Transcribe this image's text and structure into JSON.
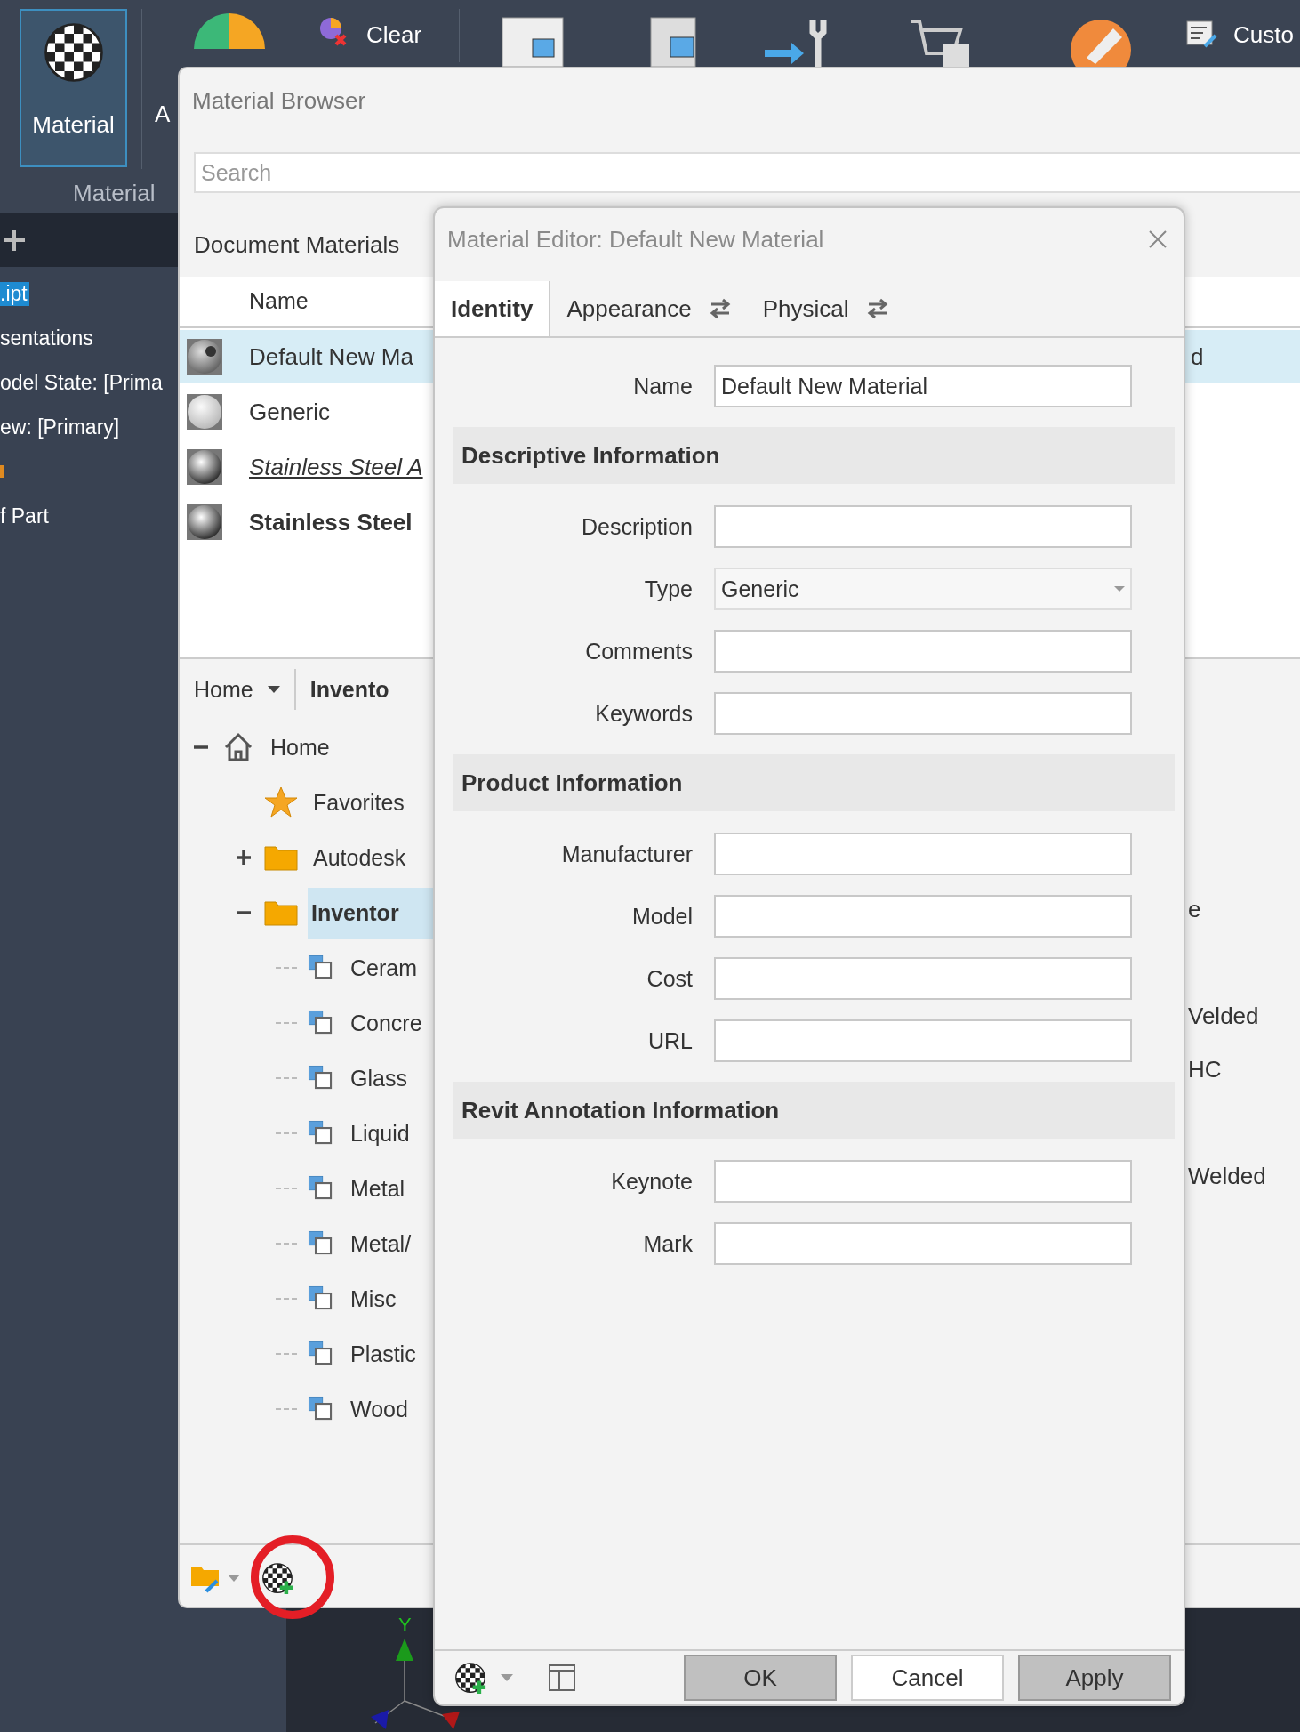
{
  "ribbon": {
    "buttons": [
      {
        "label": "Material",
        "selected": true
      },
      {
        "label": "A",
        "selected": false
      }
    ],
    "clear_label": "Clear",
    "custom_label": "Custo",
    "panel_label": "Material"
  },
  "model_tree": {
    "items": [
      {
        "kind": "text",
        "label": ".ipt",
        "selected": true
      },
      {
        "kind": "text",
        "label": "sentations",
        "selected": false
      },
      {
        "kind": "text",
        "label": "odel State: [Prima",
        "selected": false
      },
      {
        "kind": "text",
        "label": "ew: [Primary]",
        "selected": false
      },
      {
        "kind": "marker",
        "selected": false
      },
      {
        "kind": "text",
        "label": "f Part",
        "selected": false
      }
    ]
  },
  "material_browser": {
    "title": "Material Browser",
    "search": {
      "placeholder": "Search"
    },
    "document_materials": {
      "heading": "Document Materials",
      "columns": [
        "Name"
      ],
      "rows": [
        {
          "name": "Default New Ma",
          "column_2": "d",
          "kind": "new",
          "selected": true
        },
        {
          "name": "Generic",
          "kind": "generic",
          "selected": false
        },
        {
          "name": "Stainless Steel A",
          "kind": "linked",
          "selected": false
        },
        {
          "name": "Stainless Steel",
          "kind": "library",
          "selected": false
        }
      ]
    },
    "library": {
      "breadcrumb": "Home",
      "current": "Invento",
      "tree": [
        {
          "label": "Home",
          "kind": "home",
          "expanded": true,
          "selected": false,
          "children": [
            {
              "label": "Favorites",
              "kind": "favorites",
              "selected": false
            },
            {
              "label": "Autodesk",
              "kind": "folder",
              "expanded": false,
              "selected": false
            },
            {
              "label": "Inventor",
              "kind": "folder",
              "expanded": true,
              "selected": true,
              "children": [
                {
                  "label": "Ceram",
                  "kind": "category",
                  "selected": false
                },
                {
                  "label": "Concre",
                  "kind": "category",
                  "selected": false
                },
                {
                  "label": "Glass",
                  "kind": "category",
                  "selected": false
                },
                {
                  "label": "Liquid",
                  "kind": "category",
                  "selected": false
                },
                {
                  "label": "Metal",
                  "kind": "category",
                  "selected": false
                },
                {
                  "label": "Metal/",
                  "kind": "category",
                  "selected": false
                },
                {
                  "label": "Misc",
                  "kind": "category",
                  "selected": false
                },
                {
                  "label": "Plastic",
                  "kind": "category",
                  "selected": false
                },
                {
                  "label": "Wood",
                  "kind": "category",
                  "selected": false
                }
              ]
            }
          ]
        }
      ],
      "list_fragments": [
        "e",
        "Velded",
        "HC",
        "Welded"
      ]
    }
  },
  "viewport": {
    "axis_labels": [
      "Y"
    ]
  },
  "material_editor": {
    "title": "Material Editor: Default New Material",
    "tabs": [
      {
        "label": "Identity",
        "selected": true,
        "swap_icon": false
      },
      {
        "label": "Appearance",
        "selected": false,
        "swap_icon": true
      },
      {
        "label": "Physical",
        "selected": false,
        "swap_icon": true
      }
    ],
    "name_field": {
      "label": "Name",
      "value": "Default New Material"
    },
    "sections": [
      {
        "title": "Descriptive Information",
        "fields": [
          {
            "label": "Description",
            "kind": "text"
          },
          {
            "label": "Type",
            "kind": "dropdown",
            "value": "Generic"
          },
          {
            "label": "Comments",
            "kind": "text"
          },
          {
            "label": "Keywords",
            "kind": "text"
          }
        ]
      },
      {
        "title": "Product Information",
        "fields": [
          {
            "label": "Manufacturer",
            "kind": "text"
          },
          {
            "label": "Model",
            "kind": "text"
          },
          {
            "label": "Cost",
            "kind": "text"
          },
          {
            "label": "URL",
            "kind": "text"
          }
        ]
      },
      {
        "title": "Revit Annotation Information",
        "fields": [
          {
            "label": "Keynote",
            "kind": "text"
          },
          {
            "label": "Mark",
            "kind": "text"
          }
        ]
      }
    ],
    "buttons": [
      {
        "label": "OK",
        "kind": "shaded"
      },
      {
        "label": "Cancel",
        "kind": "plain"
      },
      {
        "label": "Apply",
        "kind": "shaded"
      }
    ]
  }
}
